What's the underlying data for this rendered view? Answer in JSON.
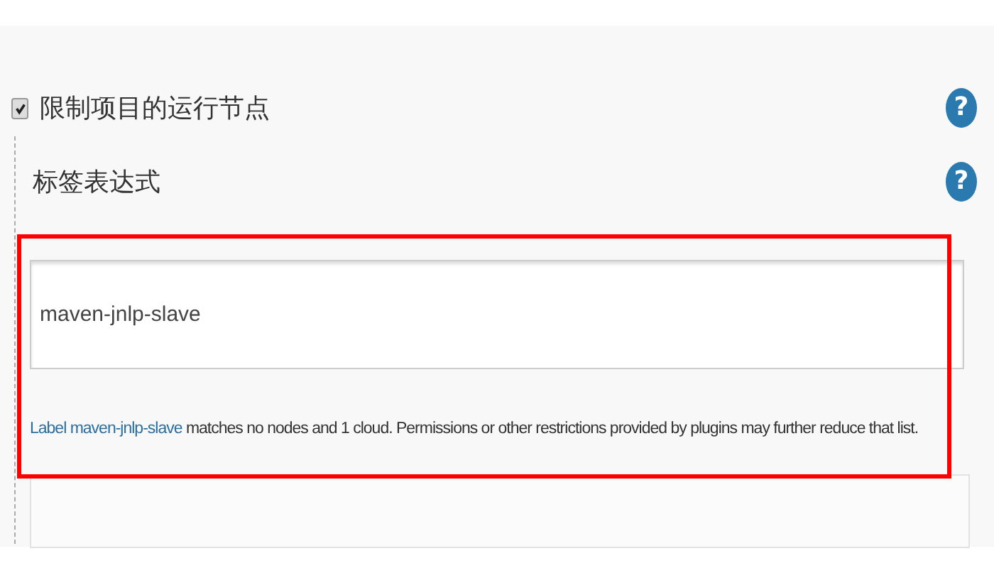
{
  "restrict_node": {
    "label": "限制项目的运行节点",
    "checked": true,
    "help": "?"
  },
  "label_expression": {
    "label": "标签表达式",
    "help": "?",
    "value": "maven-jnlp-slave",
    "link": "Label maven-jnlp-slave",
    "rest": " matches no nodes and 1 cloud. Permissions or other restrictions provided by plugins may further reduce that list."
  },
  "annotation": {
    "kind": "highlight",
    "color": "#ff0000"
  }
}
